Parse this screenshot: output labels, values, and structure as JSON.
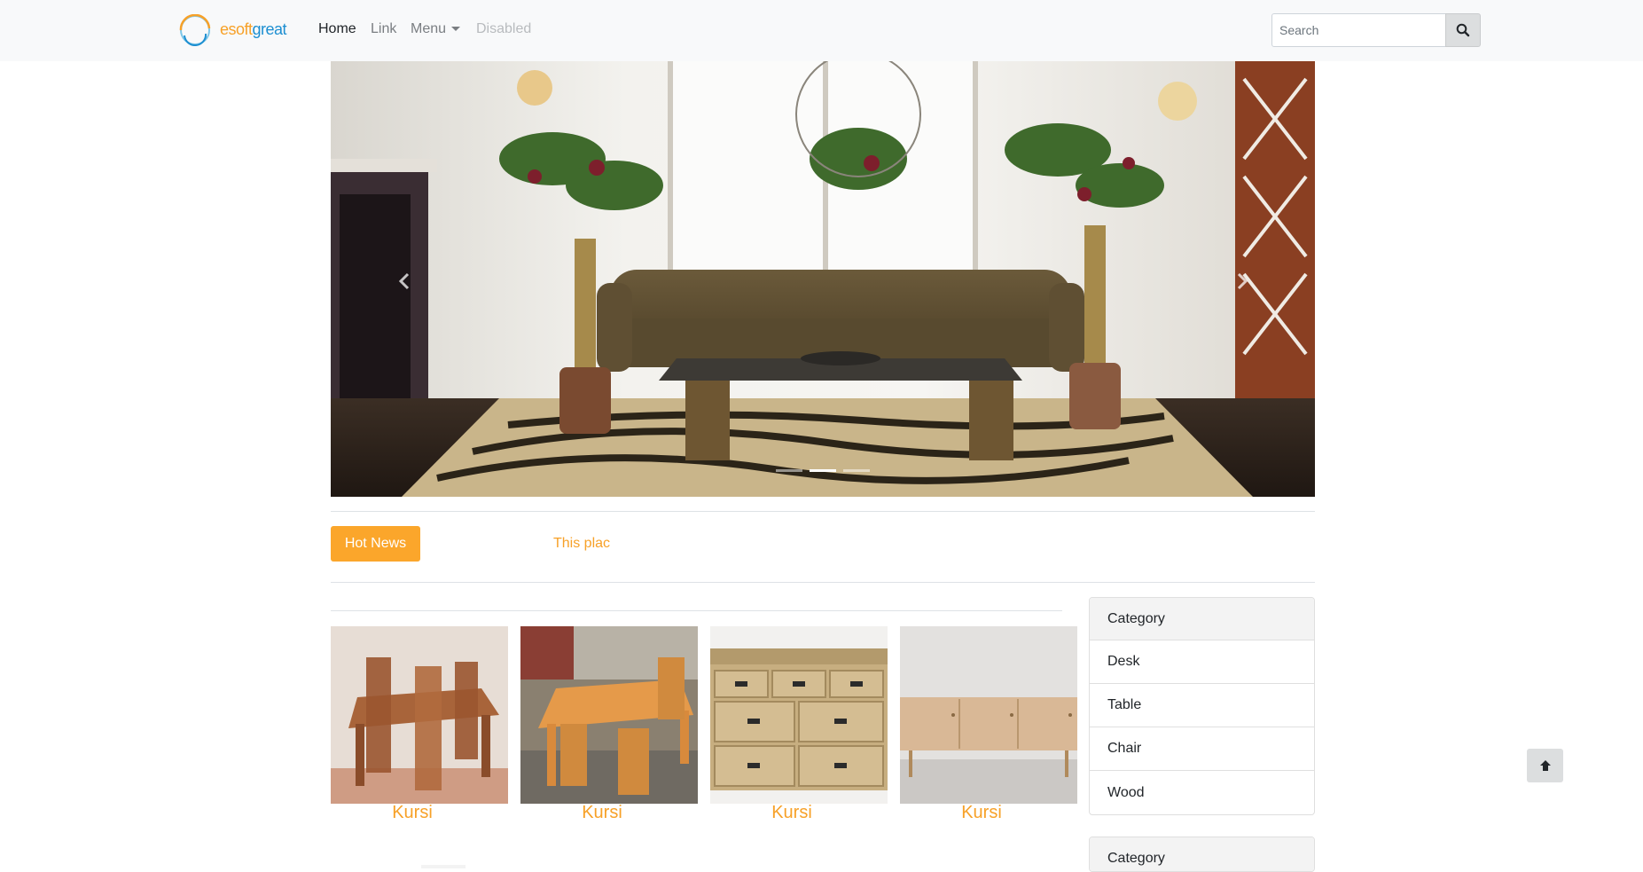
{
  "brand": {
    "logo_e": "e",
    "logo_soft": "soft",
    "logo_great": "great",
    "colors": {
      "orange": "#f7a128",
      "blue": "#1d8fd1"
    }
  },
  "nav": {
    "home": "Home",
    "link": "Link",
    "menu": "Menu",
    "disabled": "Disabled"
  },
  "search": {
    "placeholder": "Search",
    "button_icon": "search-icon"
  },
  "carousel": {
    "prev_icon": "chevron-left-icon",
    "next_icon": "chevron-right-icon",
    "slide_count": 3,
    "active_slide": 2
  },
  "news": {
    "badge": "Hot News",
    "ticker": "This plac"
  },
  "products": [
    {
      "name": "Kursi"
    },
    {
      "name": "Kursi"
    },
    {
      "name": "Kursi"
    },
    {
      "name": "Kursi"
    }
  ],
  "sidebar": {
    "card1": {
      "title": "Category",
      "items": [
        "Desk",
        "Table",
        "Chair",
        "Wood"
      ]
    },
    "card2": {
      "title": "Category"
    }
  },
  "back_to_top_icon": "arrow-up-icon"
}
